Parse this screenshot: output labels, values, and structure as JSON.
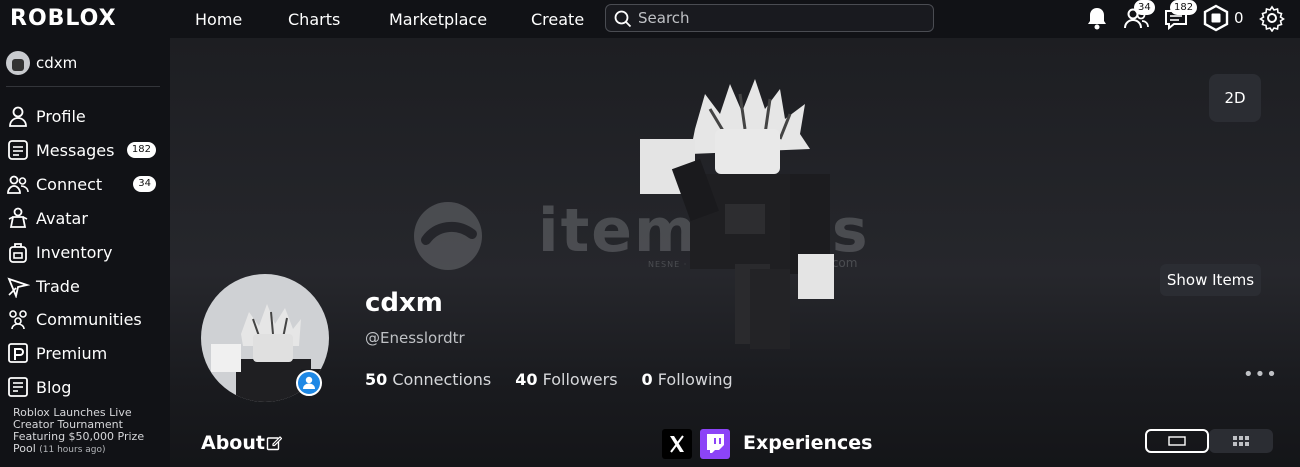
{
  "topbar": {
    "logo": "ROBLOX",
    "nav": [
      "Home",
      "Charts",
      "Marketplace",
      "Create"
    ],
    "search_placeholder": "Search",
    "friends_badge": "34",
    "messages_badge": "182",
    "robux": "0"
  },
  "sidebar": {
    "username": "cdxm",
    "items": [
      {
        "label": "Profile",
        "icon": "person-icon"
      },
      {
        "label": "Messages",
        "icon": "messages-icon",
        "badge": "182"
      },
      {
        "label": "Connect",
        "icon": "people-icon",
        "badge": "34"
      },
      {
        "label": "Avatar",
        "icon": "avatar-icon"
      },
      {
        "label": "Inventory",
        "icon": "backpack-icon"
      },
      {
        "label": "Trade",
        "icon": "trade-icon"
      },
      {
        "label": "Communities",
        "icon": "communities-icon"
      },
      {
        "label": "Premium",
        "icon": "premium-icon"
      },
      {
        "label": "Blog",
        "icon": "blog-icon"
      }
    ],
    "blog_post": "Roblox Launches Live Creator Tournament Featuring $50,000 Prize Pool",
    "blog_time": "(11 hours ago)"
  },
  "profile": {
    "display_name": "cdxm",
    "handle": "@Enesslordtr",
    "connections_count": "50",
    "connections_label": "Connections",
    "followers_count": "40",
    "followers_label": "Followers",
    "following_count": "0",
    "following_label": "Following",
    "btn_2d": "2D",
    "btn_show_items": "Show Items",
    "more": "•••"
  },
  "watermark": {
    "text": "itemsatis",
    "sub": "NESNE · OYUN · İTEM · E-PIN",
    "domain": ".com"
  },
  "sections": {
    "about": "About",
    "experiences": "Experiences"
  },
  "colors": {
    "background": "#111216",
    "online": "#1e88e5",
    "twitch": "#8c44f7"
  }
}
